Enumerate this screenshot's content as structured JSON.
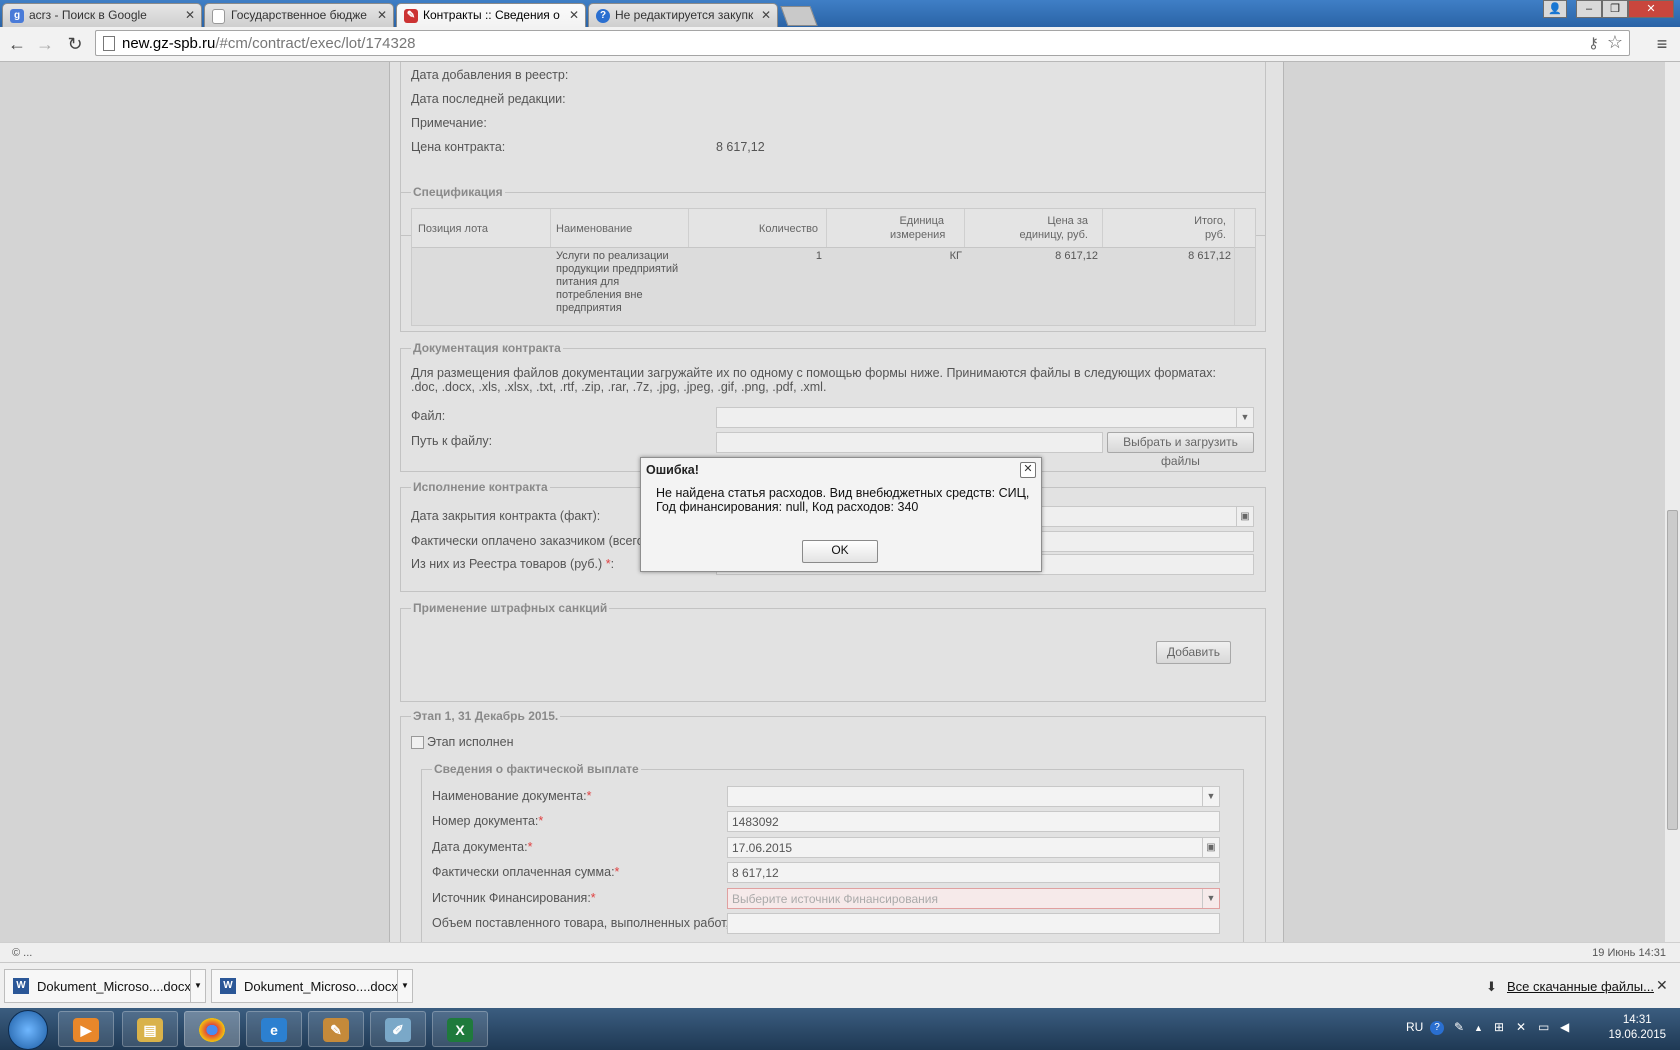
{
  "browser": {
    "tabs": [
      {
        "title": "acrз - Поиск в Google",
        "icon": "google-icon"
      },
      {
        "title": "Государственное бюдже",
        "icon": "document-icon"
      },
      {
        "title": "Контракты :: Сведения о",
        "icon": "app-icon"
      },
      {
        "title": "Не редактируется закупк",
        "icon": "help-icon"
      }
    ],
    "url_host": "new.gz-spb.ru",
    "url_path": "/#cm/contract/exec/lot/174328"
  },
  "contract_info": {
    "date_added_label": "Дата добавления в реестр:",
    "date_edited_label": "Дата последней редакции:",
    "note_label": "Примечание:",
    "price_label": "Цена контракта:",
    "price_value": "8 617,12"
  },
  "spec": {
    "legend": "Спецификация",
    "headers": [
      "Позиция лота",
      "Наименование",
      "Количество",
      "Единица измерения",
      "Цена за единицу, руб.",
      "Итого, руб."
    ],
    "rows": [
      {
        "position": "",
        "name": "Услуги по реализации продукции предприятий питания для потребления вне предприятия",
        "qty": "1",
        "unit": "КГ",
        "price": "8 617,12",
        "total": "8 617,12"
      }
    ]
  },
  "docs": {
    "legend": "Документация контракта",
    "info": "Для размещения файлов документации загружайте их по одному с помощью формы ниже. Принимаются файлы в следующих форматах: .doc, .docx, .xls, .xlsx, .txt, .rtf, .zip, .rar, .7z, .jpg, .jpeg, .gif, .png, .pdf, .xml.",
    "file_label": "Файл:",
    "path_label": "Путь к файлу:",
    "upload_button": "Выбрать и загрузить файлы"
  },
  "execution": {
    "legend": "Исполнение контракта",
    "close_date_label": "Дата закрытия контракта (факт):",
    "paid_label": "Фактически оплачено заказчиком (всего",
    "registry_label": "Из них из Реестра товаров (руб.)",
    "required_mark": "*",
    "colon": ":"
  },
  "penalties": {
    "legend": "Применение штрафных санкций",
    "add_button": "Добавить"
  },
  "stage": {
    "legend": "Этап 1, 31 Декабрь 2015.",
    "done_label": "Этап исполнен",
    "sublegend": "Сведения о фактической выплате",
    "doc_name_label": "Наименование документа:",
    "doc_number_label": "Номер документа:",
    "doc_number_value": "1483092",
    "doc_date_label": "Дата документа:",
    "doc_date_value": "17.06.2015",
    "paid_sum_label": "Фактически оплаченная сумма:",
    "paid_sum_value": "8 617,12",
    "source_label": "Источник Финансирования:",
    "source_placeholder": "Выберите источник Финансирования",
    "volume_label": "Объем поставленного товара, выполненных работ,"
  },
  "dialog": {
    "title": "Ошибка!",
    "message": "Не найдена статья расходов. Вид внебюджетных средств: СИЦ, Год финансирования: null, Код расходов: 340",
    "ok": "OK"
  },
  "status": {
    "left": "© ...",
    "right": "19 Июнь 14:31"
  },
  "downloads": {
    "items": [
      "Dokument_Microso....docx",
      "Dokument_Microso....docx"
    ],
    "all_link": "Все скачанные файлы..."
  },
  "taskbar": {
    "lang": "RU",
    "time": "14:31",
    "date": "19.06.2015"
  }
}
